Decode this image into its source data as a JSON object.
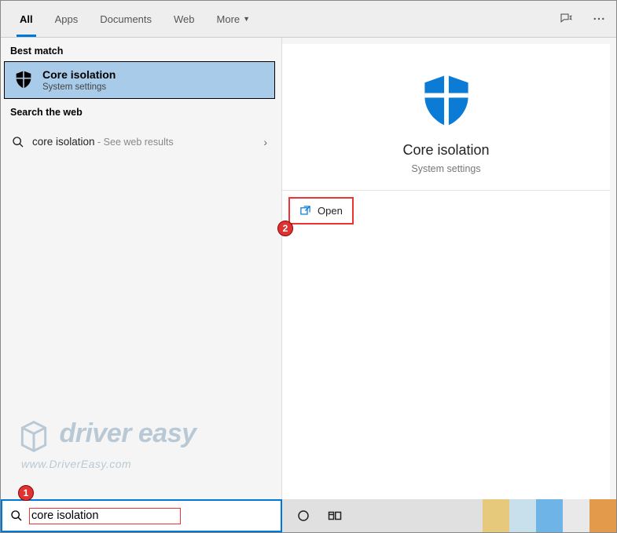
{
  "tabs": {
    "all": "All",
    "apps": "Apps",
    "documents": "Documents",
    "web": "Web",
    "more": "More"
  },
  "sections": {
    "best_match": "Best match",
    "search_web": "Search the web"
  },
  "best_match": {
    "title": "Core isolation",
    "subtitle": "System settings"
  },
  "web_result": {
    "term": "core isolation",
    "hint": " - See web results"
  },
  "preview": {
    "title": "Core isolation",
    "subtitle": "System settings",
    "open_label": "Open"
  },
  "search": {
    "value": "core isolation"
  },
  "watermark": {
    "line1": "driver easy",
    "line2": "www.DriverEasy.com"
  },
  "annotations": {
    "step1": "1",
    "step2": "2"
  }
}
